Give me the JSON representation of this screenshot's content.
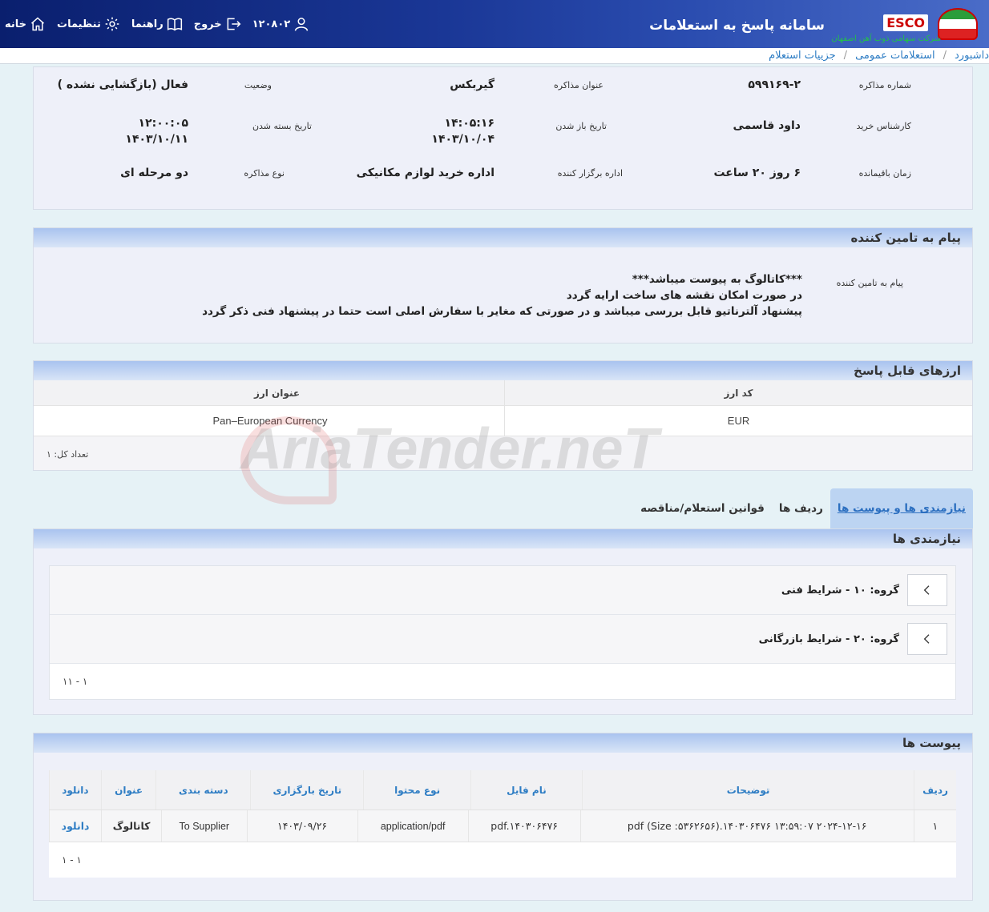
{
  "header": {
    "system_title": "سامانه پاسخ به استعلامات",
    "brand": "ESCO",
    "brand_sub": "شرکت سهامی ذوب آهن اصفهان",
    "nav": {
      "home": "خانه",
      "settings": "تنظیمات",
      "guide": "راهنما",
      "logout": "خروج",
      "user_id": "۱۲۰۸۰۲"
    }
  },
  "breadcrumb": [
    "داشبورد",
    "استعلامات عمومی",
    "جزییات استعلام"
  ],
  "info": {
    "negotiation_number_label": "شماره مذاکره",
    "negotiation_number": "۵۹۹۱۶۹-۲",
    "negotiation_title_label": "عنوان مذاکره",
    "negotiation_title": "گیربکس",
    "status_label": "وضعیت",
    "status": "فعال (بازگشایی نشده )",
    "buyer_expert_label": "کارشناس خرید",
    "buyer_expert": "داود قاسمی",
    "open_date_label": "تاریخ باز شدن",
    "open_time": "۱۴:۰۵:۱۶",
    "open_date": "۱۴۰۳/۱۰/۰۴",
    "close_date_label": "تاریخ بسته شدن",
    "close_time": "۱۲:۰۰:۰۵",
    "close_date": "۱۴۰۳/۱۰/۱۱",
    "remaining_label": "زمان باقیمانده",
    "remaining": "۶ روز ۲۰ ساعت",
    "organizer_label": "اداره برگزار کننده",
    "organizer": "اداره خرید لوازم مکانیکی",
    "type_label": "نوع مذاکره",
    "type": "دو مرحله ای"
  },
  "message": {
    "panel_title": "پیام به تامین کننده",
    "label": "پیام به تامین کننده",
    "lines": [
      "***کاتالوگ به پیوست میباشد***",
      "در صورت امکان نقشه های ساخت ارایه گردد",
      "پیشنهاد آلترناتیو قابل بررسی میباشد و در صورتی که مغایر با سفارش اصلی است حتما در پیشنهاد فنی ذکر گردد"
    ]
  },
  "currencies": {
    "panel_title": "ارزهای قابل پاسخ",
    "columns": [
      "کد ارز",
      "عنوان ارز"
    ],
    "rows": [
      [
        "EUR",
        "Pan–European Currency"
      ]
    ],
    "total": "تعداد کل: ۱"
  },
  "tabs": [
    "نیازمندی ها و پیوست ها",
    "ردیف ها",
    "قوانین استعلام/مناقصه"
  ],
  "requirements": {
    "panel_title": "نیازمندی ها",
    "groups": [
      "گروه: ۱۰ - شرایط فنی",
      "گروه: ۲۰ - شرایط بازرگانی"
    ],
    "pager": "۱ - ۱۱"
  },
  "attachments": {
    "panel_title": "پیوست ها",
    "columns": [
      "ردیف",
      "توضیحات",
      "نام فایل",
      "نوع محتوا",
      "تاریخ بارگزاری",
      "دسته بندی",
      "عنوان",
      "دانلود"
    ],
    "rows": [
      [
        "۱",
        "pdf (Size :۵۳۶۲۶۵۶).۱۴۰۳۰۶۴۷۶ ۱۳:۵۹:۰۷ ۲۰۲۴-۱۲-۱۶",
        "pdf.۱۴۰۳۰۶۴۷۶",
        "application/pdf",
        "۱۴۰۳/۰۹/۲۶",
        "To Supplier",
        "کاتالوگ",
        "دانلود"
      ]
    ],
    "pager": "۱ - ۱"
  },
  "watermark": "AriaTender.neT"
}
